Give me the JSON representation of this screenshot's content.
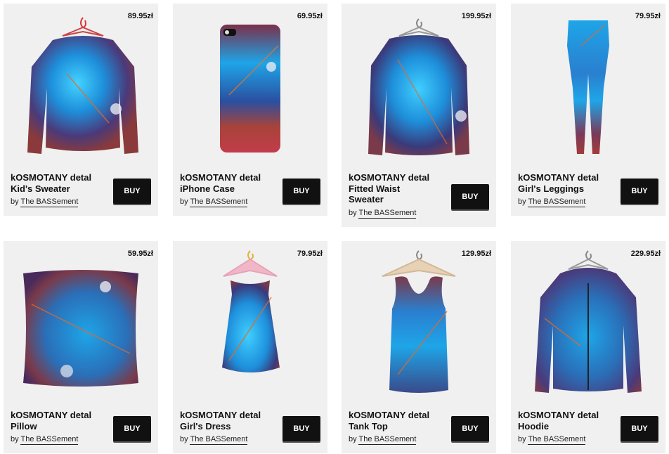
{
  "products": [
    {
      "price": "89.95zł",
      "title_line1": "kOSMOTANY detal",
      "title_line2": "Kid's Sweater",
      "title_line3": "",
      "by": "by",
      "author": "The BASSement",
      "buy": "BUY",
      "icon": "sweater-icon"
    },
    {
      "price": "69.95zł",
      "title_line1": "kOSMOTANY detal",
      "title_line2": "iPhone Case",
      "title_line3": "",
      "by": "by",
      "author": "The BASSement",
      "buy": "BUY",
      "icon": "phone-case-icon"
    },
    {
      "price": "199.95zł",
      "title_line1": "kOSMOTANY detal",
      "title_line2": "Fitted Waist",
      "title_line3": "Sweater",
      "by": "by",
      "author": "The BASSement",
      "buy": "BUY",
      "icon": "sweater-icon"
    },
    {
      "price": "79.95zł",
      "title_line1": "kOSMOTANY detal",
      "title_line2": "Girl's Leggings",
      "title_line3": "",
      "by": "by",
      "author": "The BASSement",
      "buy": "BUY",
      "icon": "leggings-icon"
    },
    {
      "price": "59.95zł",
      "title_line1": "kOSMOTANY detal",
      "title_line2": "Pillow",
      "title_line3": "",
      "by": "by",
      "author": "The BASSement",
      "buy": "BUY",
      "icon": "pillow-icon"
    },
    {
      "price": "79.95zł",
      "title_line1": "kOSMOTANY detal",
      "title_line2": "Girl's Dress",
      "title_line3": "",
      "by": "by",
      "author": "The BASSement",
      "buy": "BUY",
      "icon": "dress-icon"
    },
    {
      "price": "129.95zł",
      "title_line1": "kOSMOTANY detal",
      "title_line2": "Tank Top",
      "title_line3": "",
      "by": "by",
      "author": "The BASSement",
      "buy": "BUY",
      "icon": "tank-top-icon"
    },
    {
      "price": "229.95zł",
      "title_line1": "kOSMOTANY detal",
      "title_line2": "Hoodie",
      "title_line3": "",
      "by": "by",
      "author": "The BASSement",
      "buy": "BUY",
      "icon": "hoodie-icon"
    }
  ],
  "colors": {
    "card_bg": "#f0f0f0",
    "button_bg": "#111111",
    "button_text": "#ffffff",
    "pattern_blue": "#1ea5e8",
    "pattern_red": "#8a3a3a",
    "pattern_navy": "#2a2f6b"
  }
}
